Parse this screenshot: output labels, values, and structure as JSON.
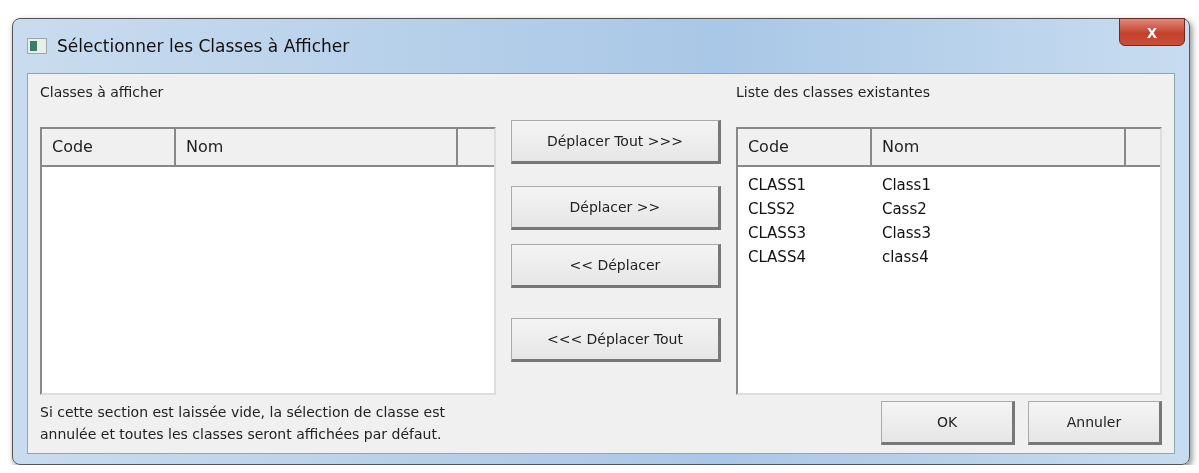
{
  "window": {
    "title": "Sélectionner les Classes à Afficher",
    "close_label": "x"
  },
  "left": {
    "label": "Classes à afficher",
    "columns": [
      "Code",
      "Nom"
    ]
  },
  "buttons": [
    "Déplacer Tout >>>",
    "Déplacer >>",
    "<< Déplacer",
    "<<< Déplacer Tout"
  ],
  "right": {
    "label": "Liste des classes existantes",
    "columns": [
      "Code",
      "Nom"
    ],
    "rows": [
      {
        "code": "CLASS1",
        "nom": "Class1"
      },
      {
        "code": "CLSS2",
        "nom": "Cass2"
      },
      {
        "code": "CLASS3",
        "nom": "Class3"
      },
      {
        "code": "CLASS4",
        "nom": "class4"
      }
    ]
  },
  "note": [
    "Si cette section est laissée vide, la sélection de classe est",
    "annulée et toutes les classes seront affichées par défaut."
  ],
  "actions": [
    "OK",
    "Annuler"
  ]
}
